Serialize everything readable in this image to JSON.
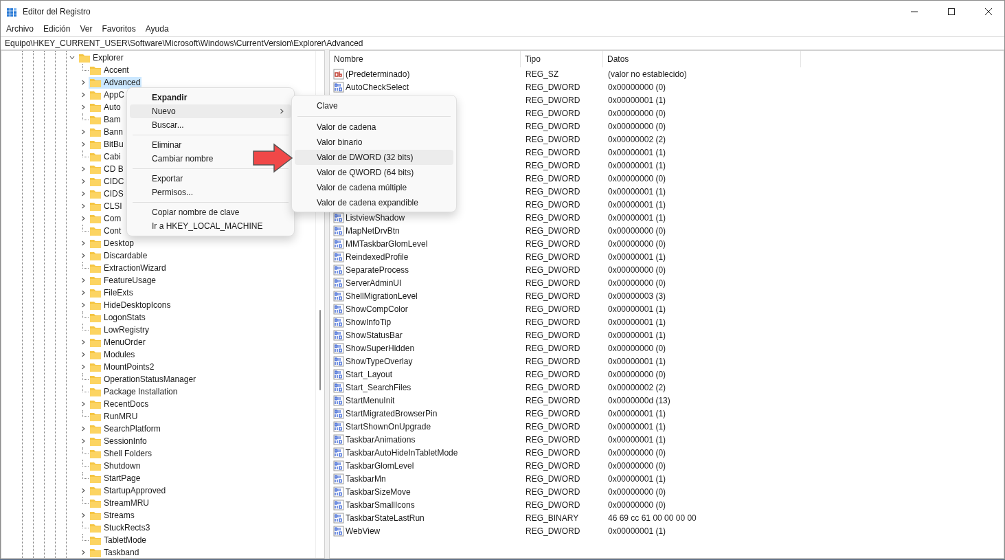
{
  "window": {
    "title": "Editor del Registro"
  },
  "menu_bar": [
    "Archivo",
    "Edición",
    "Ver",
    "Favoritos",
    "Ayuda"
  ],
  "address": "Equipo\\HKEY_CURRENT_USER\\Software\\Microsoft\\Windows\\CurrentVersion\\Explorer\\Advanced",
  "tree": {
    "items": [
      {
        "label": "Explorer",
        "expanded": true,
        "selected": false,
        "children": [
          {
            "label": "Accent",
            "expandable": false,
            "selected": false
          },
          {
            "label": "Advanced",
            "expandable": true,
            "selected": true
          },
          {
            "label": "AppC",
            "expandable": true,
            "selected": false
          },
          {
            "label": "Auto",
            "expandable": true,
            "selected": false
          },
          {
            "label": "Bam",
            "expandable": false,
            "selected": false
          },
          {
            "label": "Bann",
            "expandable": true,
            "selected": false
          },
          {
            "label": "BitBu",
            "expandable": true,
            "selected": false
          },
          {
            "label": "Cabi",
            "expandable": false,
            "selected": false
          },
          {
            "label": "CD B",
            "expandable": true,
            "selected": false
          },
          {
            "label": "CIDC",
            "expandable": true,
            "selected": false
          },
          {
            "label": "CIDS",
            "expandable": true,
            "selected": false
          },
          {
            "label": "CLSI",
            "expandable": true,
            "selected": false
          },
          {
            "label": "Com",
            "expandable": true,
            "selected": false
          },
          {
            "label": "Cont",
            "expandable": false,
            "selected": false
          },
          {
            "label": "Desktop",
            "expandable": true,
            "selected": false
          },
          {
            "label": "Discardable",
            "expandable": true,
            "selected": false
          },
          {
            "label": "ExtractionWizard",
            "expandable": false,
            "selected": false
          },
          {
            "label": "FeatureUsage",
            "expandable": true,
            "selected": false
          },
          {
            "label": "FileExts",
            "expandable": true,
            "selected": false
          },
          {
            "label": "HideDesktopIcons",
            "expandable": true,
            "selected": false
          },
          {
            "label": "LogonStats",
            "expandable": false,
            "selected": false
          },
          {
            "label": "LowRegistry",
            "expandable": false,
            "selected": false
          },
          {
            "label": "MenuOrder",
            "expandable": true,
            "selected": false
          },
          {
            "label": "Modules",
            "expandable": true,
            "selected": false
          },
          {
            "label": "MountPoints2",
            "expandable": true,
            "selected": false
          },
          {
            "label": "OperationStatusManager",
            "expandable": false,
            "selected": false
          },
          {
            "label": "Package Installation",
            "expandable": false,
            "selected": false
          },
          {
            "label": "RecentDocs",
            "expandable": true,
            "selected": false
          },
          {
            "label": "RunMRU",
            "expandable": false,
            "selected": false
          },
          {
            "label": "SearchPlatform",
            "expandable": true,
            "selected": false
          },
          {
            "label": "SessionInfo",
            "expandable": true,
            "selected": false
          },
          {
            "label": "Shell Folders",
            "expandable": false,
            "selected": false
          },
          {
            "label": "Shutdown",
            "expandable": false,
            "selected": false
          },
          {
            "label": "StartPage",
            "expandable": false,
            "selected": false
          },
          {
            "label": "StartupApproved",
            "expandable": true,
            "selected": false
          },
          {
            "label": "StreamMRU",
            "expandable": false,
            "selected": false
          },
          {
            "label": "Streams",
            "expandable": true,
            "selected": false
          },
          {
            "label": "StuckRects3",
            "expandable": false,
            "selected": false
          },
          {
            "label": "TabletMode",
            "expandable": false,
            "selected": false
          },
          {
            "label": "Taskband",
            "expandable": true,
            "selected": false
          }
        ]
      }
    ]
  },
  "values": {
    "columns": [
      "Nombre",
      "Tipo",
      "Datos"
    ],
    "rows": [
      {
        "kind": "string",
        "name": "(Predeterminado)",
        "type": "REG_SZ",
        "data": "(valor no establecido)"
      },
      {
        "kind": "binary",
        "name": "AutoCheckSelect",
        "type": "REG_DWORD",
        "data": "0x00000000 (0)"
      },
      {
        "type": "REG_DWORD",
        "data": "0x00000001 (1)"
      },
      {
        "type": "REG_DWORD",
        "data": "0x00000000 (0)"
      },
      {
        "type": "REG_DWORD",
        "data": "0x00000000 (0)"
      },
      {
        "type": "REG_DWORD",
        "data": "0x00000002 (2)"
      },
      {
        "type": "REG_DWORD",
        "data": "0x00000001 (1)"
      },
      {
        "type": "REG_DWORD",
        "data": "0x00000001 (1)"
      },
      {
        "type": "REG_DWORD",
        "data": "0x00000000 (0)"
      },
      {
        "type": "REG_DWORD",
        "data": "0x00000001 (1)"
      },
      {
        "type": "REG_DWORD",
        "data": "0x00000001 (1)"
      },
      {
        "kind": "binary",
        "name": "ListviewShadow",
        "type": "REG_DWORD",
        "data": "0x00000001 (1)"
      },
      {
        "kind": "binary",
        "name": "MapNetDrvBtn",
        "type": "REG_DWORD",
        "data": "0x00000000 (0)"
      },
      {
        "kind": "binary",
        "name": "MMTaskbarGlomLevel",
        "type": "REG_DWORD",
        "data": "0x00000000 (0)"
      },
      {
        "kind": "binary",
        "name": "ReindexedProfile",
        "type": "REG_DWORD",
        "data": "0x00000001 (1)"
      },
      {
        "kind": "binary",
        "name": "SeparateProcess",
        "type": "REG_DWORD",
        "data": "0x00000000 (0)"
      },
      {
        "kind": "binary",
        "name": "ServerAdminUI",
        "type": "REG_DWORD",
        "data": "0x00000000 (0)"
      },
      {
        "kind": "binary",
        "name": "ShellMigrationLevel",
        "type": "REG_DWORD",
        "data": "0x00000003 (3)"
      },
      {
        "kind": "binary",
        "name": "ShowCompColor",
        "type": "REG_DWORD",
        "data": "0x00000001 (1)"
      },
      {
        "kind": "binary",
        "name": "ShowInfoTip",
        "type": "REG_DWORD",
        "data": "0x00000001 (1)"
      },
      {
        "kind": "binary",
        "name": "ShowStatusBar",
        "type": "REG_DWORD",
        "data": "0x00000001 (1)"
      },
      {
        "kind": "binary",
        "name": "ShowSuperHidden",
        "type": "REG_DWORD",
        "data": "0x00000000 (0)"
      },
      {
        "kind": "binary",
        "name": "ShowTypeOverlay",
        "type": "REG_DWORD",
        "data": "0x00000001 (1)"
      },
      {
        "kind": "binary",
        "name": "Start_Layout",
        "type": "REG_DWORD",
        "data": "0x00000000 (0)"
      },
      {
        "kind": "binary",
        "name": "Start_SearchFiles",
        "type": "REG_DWORD",
        "data": "0x00000002 (2)"
      },
      {
        "kind": "binary",
        "name": "StartMenuInit",
        "type": "REG_DWORD",
        "data": "0x0000000d (13)"
      },
      {
        "kind": "binary",
        "name": "StartMigratedBrowserPin",
        "type": "REG_DWORD",
        "data": "0x00000001 (1)"
      },
      {
        "kind": "binary",
        "name": "StartShownOnUpgrade",
        "type": "REG_DWORD",
        "data": "0x00000001 (1)"
      },
      {
        "kind": "binary",
        "name": "TaskbarAnimations",
        "type": "REG_DWORD",
        "data": "0x00000001 (1)"
      },
      {
        "kind": "binary",
        "name": "TaskbarAutoHideInTabletMode",
        "type": "REG_DWORD",
        "data": "0x00000000 (0)"
      },
      {
        "kind": "binary",
        "name": "TaskbarGlomLevel",
        "type": "REG_DWORD",
        "data": "0x00000000 (0)"
      },
      {
        "kind": "binary",
        "name": "TaskbarMn",
        "type": "REG_DWORD",
        "data": "0x00000001 (1)"
      },
      {
        "kind": "binary",
        "name": "TaskbarSizeMove",
        "type": "REG_DWORD",
        "data": "0x00000000 (0)"
      },
      {
        "kind": "binary",
        "name": "TaskbarSmallIcons",
        "type": "REG_DWORD",
        "data": "0x00000000 (0)"
      },
      {
        "kind": "binary",
        "name": "TaskbarStateLastRun",
        "type": "REG_BINARY",
        "data": "46 69 cc 61 00 00 00 00"
      },
      {
        "kind": "binary",
        "name": "WebView",
        "type": "REG_DWORD",
        "data": "0x00000001 (1)"
      }
    ]
  },
  "context_menu": {
    "items": [
      {
        "kind": "item",
        "label": "Expandir",
        "default": true,
        "selected": false
      },
      {
        "kind": "item",
        "label": "Nuevo",
        "selected": true,
        "submenu": true
      },
      {
        "kind": "item",
        "label": "Buscar...",
        "selected": false
      },
      {
        "kind": "separator"
      },
      {
        "kind": "item",
        "label": "Eliminar",
        "selected": false
      },
      {
        "kind": "item",
        "label": "Cambiar nombre",
        "selected": false
      },
      {
        "kind": "separator"
      },
      {
        "kind": "item",
        "label": "Exportar",
        "selected": false
      },
      {
        "kind": "item",
        "label": "Permisos...",
        "selected": false
      },
      {
        "kind": "separator"
      },
      {
        "kind": "item",
        "label": "Copiar nombre de clave",
        "selected": false
      },
      {
        "kind": "item",
        "label": "Ir a HKEY_LOCAL_MACHINE",
        "selected": false
      }
    ]
  },
  "submenu": {
    "items": [
      {
        "kind": "item",
        "label": "Clave",
        "selected": false
      },
      {
        "kind": "separator"
      },
      {
        "kind": "item",
        "label": "Valor de cadena",
        "selected": false
      },
      {
        "kind": "item",
        "label": "Valor binario",
        "selected": false
      },
      {
        "kind": "item",
        "label": "Valor de DWORD (32 bits)",
        "selected": true
      },
      {
        "kind": "item",
        "label": "Valor de QWORD (64 bits)",
        "selected": false
      },
      {
        "kind": "item",
        "label": "Valor de cadena múltiple",
        "selected": false
      },
      {
        "kind": "item",
        "label": "Valor de cadena expandible",
        "selected": false
      }
    ]
  }
}
